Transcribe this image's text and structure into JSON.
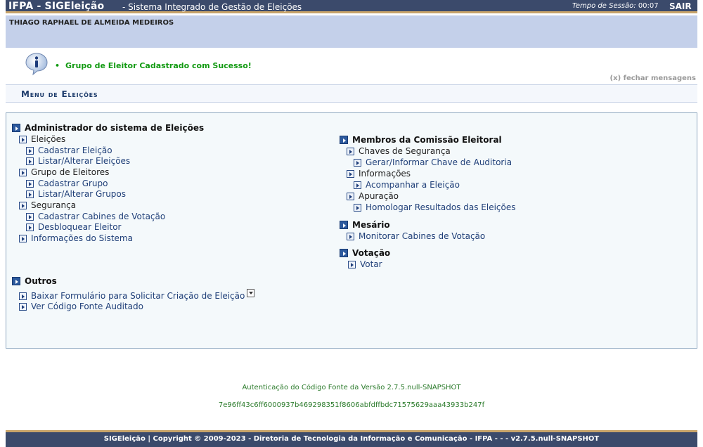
{
  "header": {
    "system_name": "IFPA - SIGEleição",
    "subtitle": "- Sistema Integrado de Gestão de Eleições",
    "session_label": "Tempo de Sessão:",
    "session_time": "00:07",
    "logout": "SAIR"
  },
  "user": {
    "name": "THIAGO RAPHAEL DE ALMEIDA MEDEIROS"
  },
  "messages": {
    "success": "Grupo de Eleitor Cadastrado com Sucesso!",
    "close": "(x) fechar mensagens"
  },
  "menu": {
    "title": "Menu de Eleições",
    "admin": {
      "header": "Administrador do sistema de Eleições",
      "eleicoes": "Eleições",
      "cadastrar_eleicao": "Cadastrar Eleição",
      "listar_eleicoes": "Listar/Alterar Eleições",
      "grupo_eleitores": "Grupo de Eleitores",
      "cadastrar_grupo": "Cadastrar Grupo",
      "listar_grupos": "Listar/Alterar Grupos",
      "seguranca": "Segurança",
      "cadastrar_cabines": "Cadastrar Cabines de Votação",
      "desbloquear_eleitor": "Desbloquear Eleitor",
      "informacoes_sistema": "Informações do Sistema"
    },
    "outros": {
      "header": "Outros",
      "baixar_formulario": "Baixar Formulário para Solicitar Criação de Eleição",
      "ver_codigo": "Ver Código Fonte Auditado"
    },
    "comissao": {
      "header": "Membros da Comissão Eleitoral",
      "chaves": "Chaves de Segurança",
      "gerar_chave": "Gerar/Informar Chave de Auditoria",
      "informacoes": "Informações",
      "acompanhar": "Acompanhar a Eleição",
      "apuracao": "Apuração",
      "homologar": "Homologar Resultados das Eleições"
    },
    "mesario": {
      "header": "Mesário",
      "monitorar": "Monitorar Cabines de Votação"
    },
    "votacao": {
      "header": "Votação",
      "votar": "Votar"
    }
  },
  "footer": {
    "auth_version": "Autenticação do Código Fonte da Versão 2.7.5.null-SNAPSHOT",
    "auth_hash": "7e96ff43c6ff6000937b469298351f8606abfdffbdc71575629aaa43933b247f",
    "copyright": "SIGEleição | Copyright © 2009-2023 - Diretoria de Tecnologia da Informação e Comunicação - IFPA - - - v2.7.5.null-SNAPSHOT"
  },
  "colors": {
    "topbar": "#3b4a6b",
    "accent_strip": "#c8a46a",
    "user_band": "#c4d0ea",
    "success_text": "#129a12",
    "link": "#1f3f78"
  }
}
